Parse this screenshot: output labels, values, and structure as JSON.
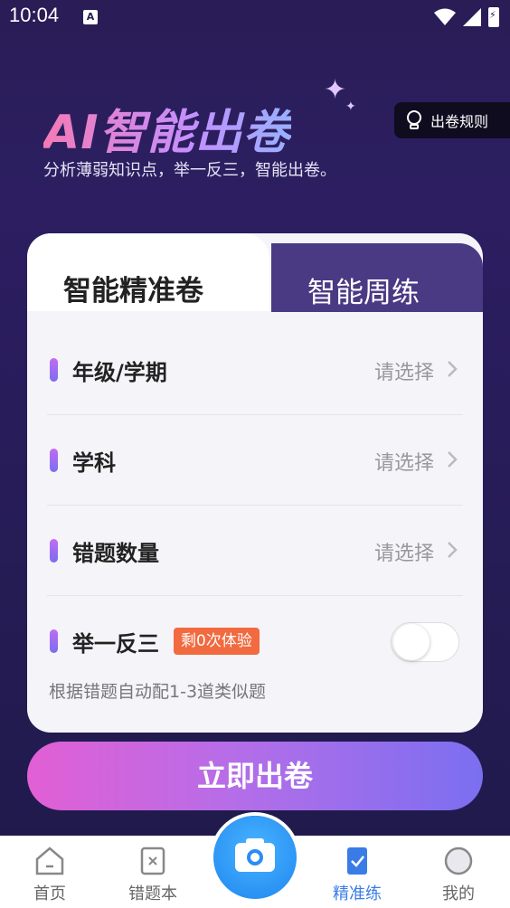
{
  "status_bar": {
    "time": "10:04",
    "notif_letter": "A"
  },
  "header": {
    "title": "AI智能出卷",
    "subtitle": "分析薄弱知识点，举一反三，智能出卷。",
    "rules_button": "出卷规则"
  },
  "tabs": [
    {
      "label": "智能精准卷",
      "active": true
    },
    {
      "label": "智能周练",
      "active": false
    }
  ],
  "form": {
    "rows": [
      {
        "label": "年级/学期",
        "value": "请选择"
      },
      {
        "label": "学科",
        "value": "请选择"
      },
      {
        "label": "错题数量",
        "value": "请选择"
      }
    ],
    "toggle_row": {
      "label": "举一反三",
      "badge": "剩0次体验",
      "enabled": false,
      "note": "根据错题自动配1-3道类似题"
    }
  },
  "cta_label": "立即出卷",
  "bottom_nav": {
    "items": [
      {
        "label": "首页",
        "icon": "home-icon",
        "active": false
      },
      {
        "label": "错题本",
        "icon": "notebook-icon",
        "active": false
      },
      {
        "label": "精准练",
        "icon": "check-doc-icon",
        "active": true
      },
      {
        "label": "我的",
        "icon": "profile-icon",
        "active": false
      }
    ],
    "center_icon": "camera-icon"
  },
  "colors": {
    "accent": "#3a7ce6",
    "badge": "#f26a3f",
    "cta_start": "#e25fd4",
    "cta_end": "#7a6ff0"
  }
}
